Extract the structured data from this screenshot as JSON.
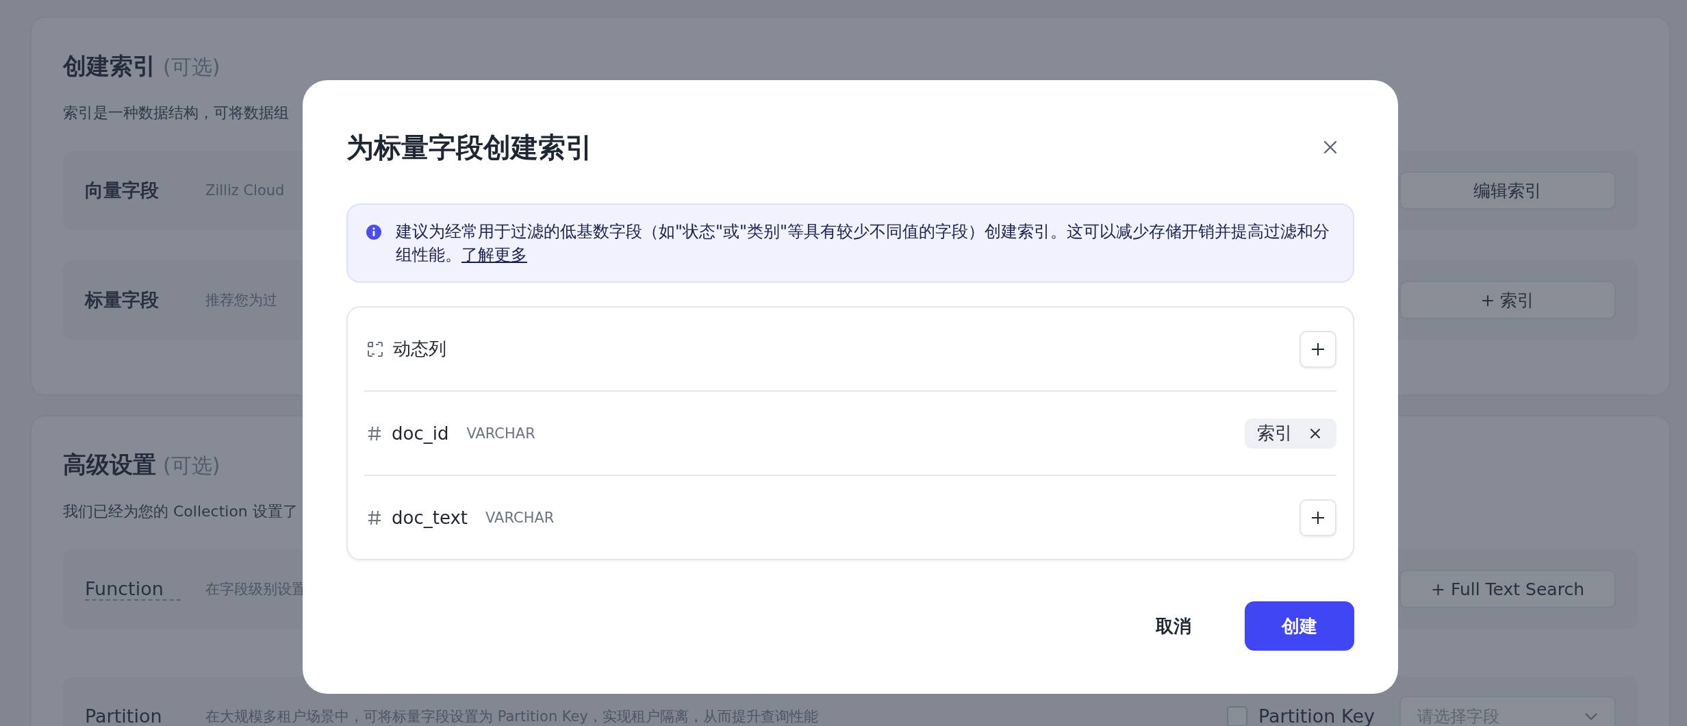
{
  "background": {
    "sections": [
      {
        "title": "创建索引",
        "optional": "(可选)",
        "description": "索引是一种数据结构，可将数据组",
        "rows": [
          {
            "kind": "plain",
            "label": "向量字段",
            "description": "Zilliz Cloud",
            "action": "编辑索引"
          },
          {
            "kind": "plain",
            "label": "标量字段",
            "description": "推荐您为过",
            "action": "+ 索引"
          }
        ]
      },
      {
        "title": "高级设置",
        "optional": "(可选)",
        "description": "我们已经为您的 Collection 设置了",
        "rows": [
          {
            "kind": "dotted",
            "label": "Function",
            "description": "在字段级别设置",
            "action": "+ Full Text Search"
          },
          {
            "kind": "select",
            "label": "Partition",
            "description": "在大规模多租户场景中，可将标量字段设置为 Partition Key，实现租户隔离，从而提升查询性能",
            "checkbox_label": "Partition Key",
            "checked": false,
            "placeholder": "请选择字段"
          }
        ]
      }
    ]
  },
  "dialog": {
    "title": "为标量字段创建索引",
    "info": {
      "text": "建议为经常用于过滤的低基数字段（如\"状态\"或\"类别\"等具有较少不同值的字段）创建索引。这可以减少存储开销并提高过滤和分组性能。",
      "link": "了解更多"
    },
    "fields": [
      {
        "kind": "dynamic",
        "name": "动态列",
        "indexed": false
      },
      {
        "kind": "scalar",
        "name": "doc_id",
        "type": "VARCHAR",
        "indexed": true,
        "tag": "索引"
      },
      {
        "kind": "scalar",
        "name": "doc_text",
        "type": "VARCHAR",
        "indexed": false
      }
    ],
    "buttons": [
      {
        "kind": "text",
        "label": "取消"
      },
      {
        "kind": "primary",
        "label": "创建"
      }
    ]
  }
}
